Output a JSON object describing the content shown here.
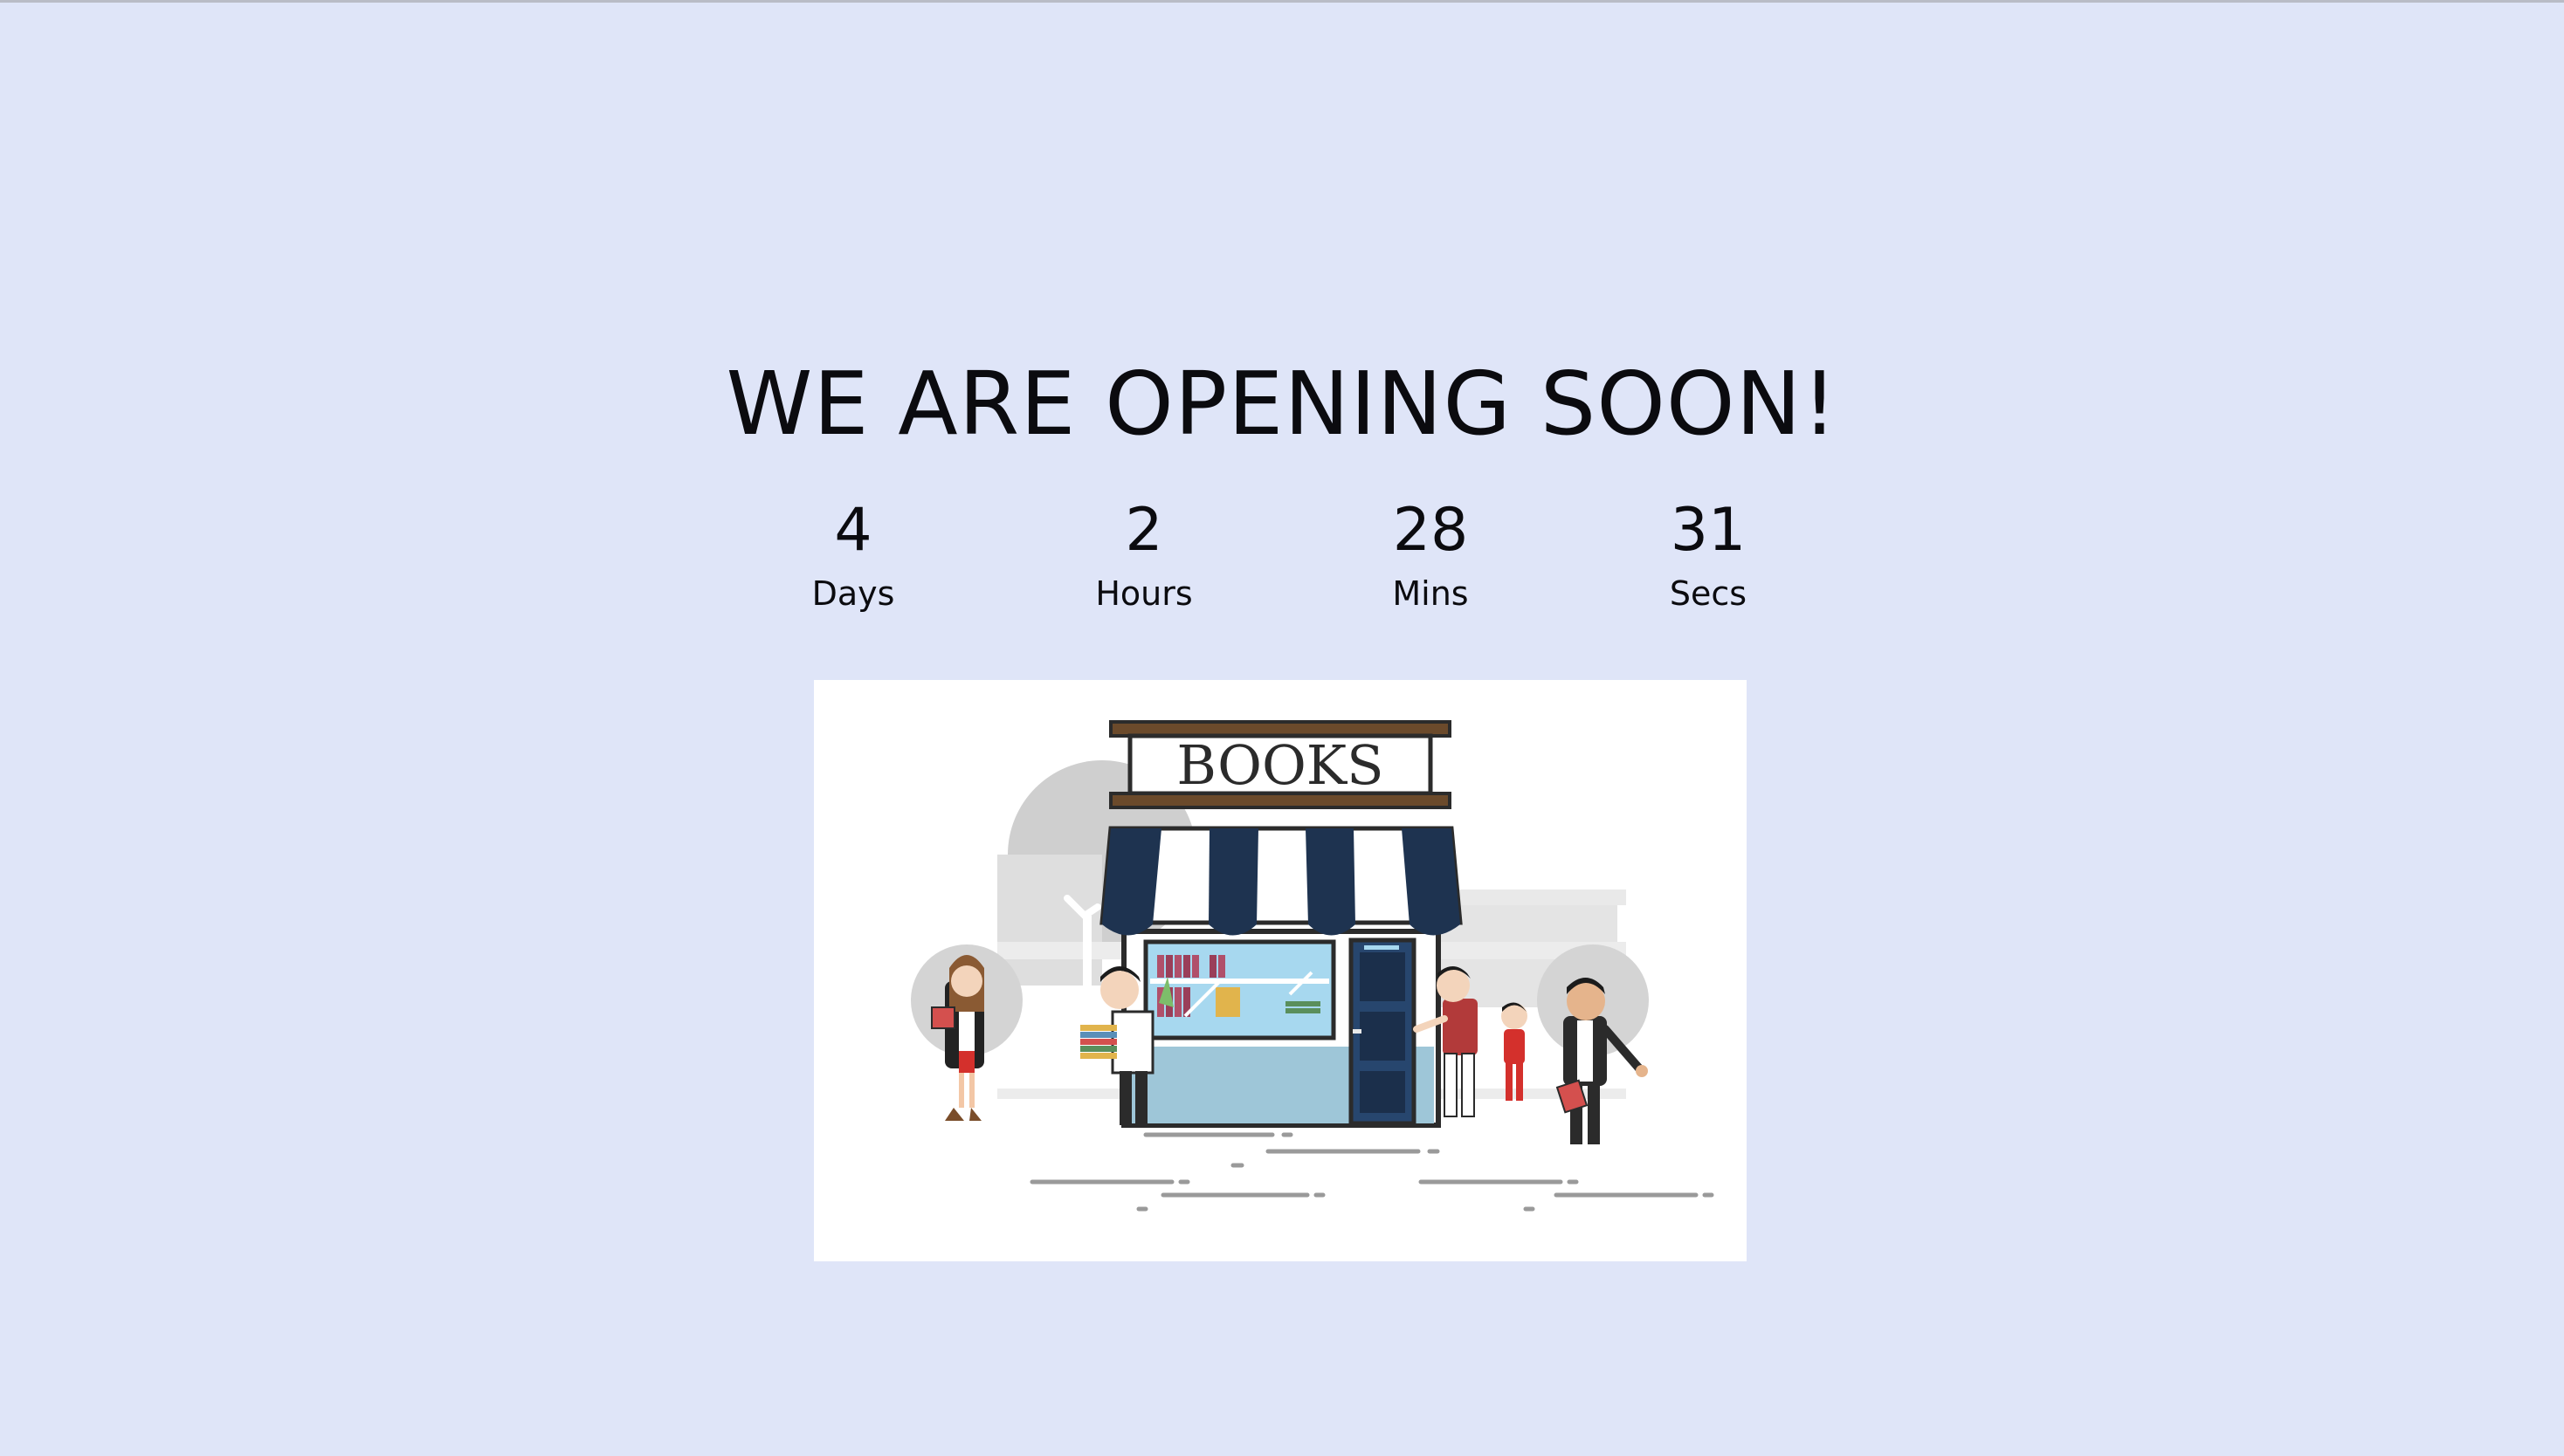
{
  "heading": "WE ARE OPENING SOON!",
  "countdown": [
    {
      "value": "4",
      "label": "Days"
    },
    {
      "value": "2",
      "label": "Hours"
    },
    {
      "value": "28",
      "label": "Mins"
    },
    {
      "value": "31",
      "label": "Secs"
    }
  ],
  "illustration": {
    "sign_text": "BOOKS"
  },
  "colors": {
    "background": "#dfe5f8",
    "text": "#0b0b0f",
    "awning_dark": "#1e3350",
    "sign_wood": "#6b4a2b"
  }
}
